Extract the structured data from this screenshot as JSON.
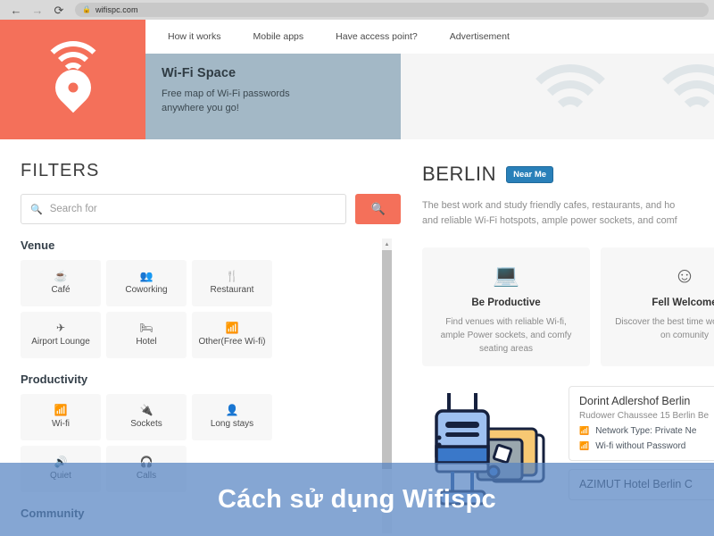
{
  "browser": {
    "back_icon": "arrow-left",
    "forward_icon": "arrow-right",
    "reload_icon": "reload",
    "lock_icon": "lock",
    "url": "wifispc.com"
  },
  "header": {
    "logo_icon": "wifi-location-pin-icon",
    "nav": [
      {
        "label": "How it works"
      },
      {
        "label": "Mobile apps"
      },
      {
        "label": "Have access point?"
      },
      {
        "label": "Advertisement"
      }
    ],
    "banner": {
      "title": "Wi-Fi Space",
      "subtitle_line1": "Free map of Wi-Fi passwords",
      "subtitle_line2": "anywhere you go!"
    },
    "decor_icon": "wifi-signal-icon"
  },
  "filters": {
    "title": "FILTERS",
    "search": {
      "placeholder": "Search for",
      "value": "",
      "icon": "search-icon",
      "button_icon": "search-icon"
    },
    "scroll": {
      "up_arrow": "▲"
    },
    "groups": [
      {
        "name": "Venue",
        "items": [
          {
            "label": "Café",
            "icon": "coffee-cup-icon",
            "glyph": "☕"
          },
          {
            "label": "Coworking",
            "icon": "coworking-people-icon",
            "glyph": "👥"
          },
          {
            "label": "Restaurant",
            "icon": "cutlery-icon",
            "glyph": "🍴"
          },
          {
            "label": "Airport Lounge",
            "icon": "airplane-icon",
            "glyph": "✈"
          },
          {
            "label": "Hotel",
            "icon": "hotel-bed-icon",
            "glyph": "🛏"
          },
          {
            "label": "Other(Free Wi-fi)",
            "icon": "wifi-hand-icon",
            "glyph": "📶"
          }
        ]
      },
      {
        "name": "Productivity",
        "items": [
          {
            "label": "Wi-fi",
            "icon": "wifi-icon",
            "glyph": "📶"
          },
          {
            "label": "Sockets",
            "icon": "power-plug-icon",
            "glyph": "🔌"
          },
          {
            "label": "Long stays",
            "icon": "person-clock-icon",
            "glyph": "👤"
          },
          {
            "label": "Quiet",
            "icon": "speaker-icon",
            "glyph": "🔊"
          },
          {
            "label": "Calls",
            "icon": "headphones-icon",
            "glyph": "🎧"
          }
        ]
      },
      {
        "name": "Community",
        "items": []
      }
    ]
  },
  "content": {
    "city": "BERLIN",
    "near_me_badge": "Near Me",
    "description_line1": "The best work and study friendly cafes, restaurants, and ho",
    "description_line2": "and reliable Wi-Fi hotspots, ample power sockets, and comf",
    "feature_cards": [
      {
        "icon": "laptop-icon",
        "glyph": "💻",
        "title": "Be Productive",
        "desc": "Find venues with reliable Wi-fi, ample Power sockets, and comfy seating areas"
      },
      {
        "icon": "smiley-face-icon",
        "glyph": "🙂",
        "title": "Fell Welcome",
        "desc": "Discover the best time work, based on comunity"
      }
    ],
    "illustration_icon": "router-and-cards-illustration",
    "listings": [
      {
        "name": "Dorint Adlershof Berlin",
        "address": "Rudower Chaussee 15 Berlin Be",
        "rows": [
          {
            "icon": "wifi-icon",
            "glyph": "📶",
            "text": "Network Type: Private Ne",
            "color": "coral"
          },
          {
            "icon": "wifi-no-password-icon",
            "glyph": "📶",
            "text": "Wi-fi without Password",
            "color": "violet"
          }
        ]
      },
      {
        "name": "AZIMUT Hotel Berlin C",
        "address": "",
        "rows": []
      }
    ]
  },
  "overlay": {
    "text": "Cách sử dụng Wifispc",
    "color": "#5683c2"
  },
  "colors": {
    "accent": "#f4705a",
    "banner": "#a3b8c6",
    "badge": "#2980b9",
    "overlay": "#5683c2"
  }
}
